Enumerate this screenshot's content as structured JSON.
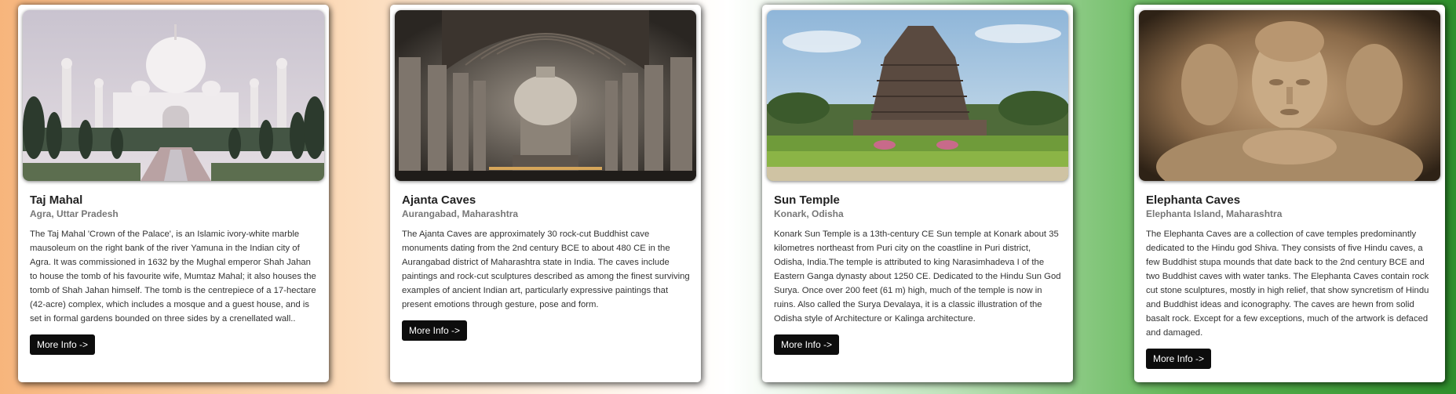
{
  "cards": [
    {
      "title": "Taj Mahal",
      "location": "Agra, Uttar Pradesh",
      "description": "The Taj Mahal 'Crown of the Palace', is an Islamic ivory-white marble mausoleum on the right bank of the river Yamuna in the Indian city of Agra. It was commissioned in 1632 by the Mughal emperor Shah Jahan to house the tomb of his favourite wife, Mumtaz Mahal; it also houses the tomb of Shah Jahan himself. The tomb is the centrepiece of a 17-hectare (42-acre) complex, which includes a mosque and a guest house, and is set in formal gardens bounded on three sides by a crenellated wall..",
      "button_label": "More Info ->"
    },
    {
      "title": "Ajanta Caves",
      "location": "Aurangabad, Maharashtra",
      "description": "The Ajanta Caves are approximately 30 rock-cut Buddhist cave monuments dating from the 2nd century BCE to about 480 CE in the Aurangabad district of Maharashtra state in India. The caves include paintings and rock-cut sculptures described as among the finest surviving examples of ancient Indian art, particularly expressive paintings that present emotions through gesture, pose and form.",
      "button_label": "More Info ->"
    },
    {
      "title": "Sun Temple",
      "location": "Konark, Odisha",
      "description": "Konark Sun Temple is a 13th-century CE Sun temple at Konark about 35 kilometres northeast from Puri city on the coastline in Puri district, Odisha, India.The temple is attributed to king Narasimhadeva I of the Eastern Ganga dynasty about 1250 CE. Dedicated to the Hindu Sun God Surya. Once over 200 feet (61 m) high, much of the temple is now in ruins. Also called the Surya Devalaya, it is a classic illustration of the Odisha style of Architecture or Kalinga architecture.",
      "button_label": "More Info ->"
    },
    {
      "title": "Elephanta Caves",
      "location": "Elephanta Island, Maharashtra",
      "description": "The Elephanta Caves are a collection of cave temples predominantly dedicated to the Hindu god Shiva. They consists of five Hindu caves, a few Buddhist stupa mounds that date back to the 2nd century BCE and two Buddhist caves with water tanks. The Elephanta Caves contain rock cut stone sculptures, mostly in high relief, that show syncretism of Hindu and Buddhist ideas and iconography. The caves are hewn from solid basalt rock. Except for a few exceptions, much of the artwork is defaced and damaged.",
      "button_label": "More Info ->"
    }
  ]
}
